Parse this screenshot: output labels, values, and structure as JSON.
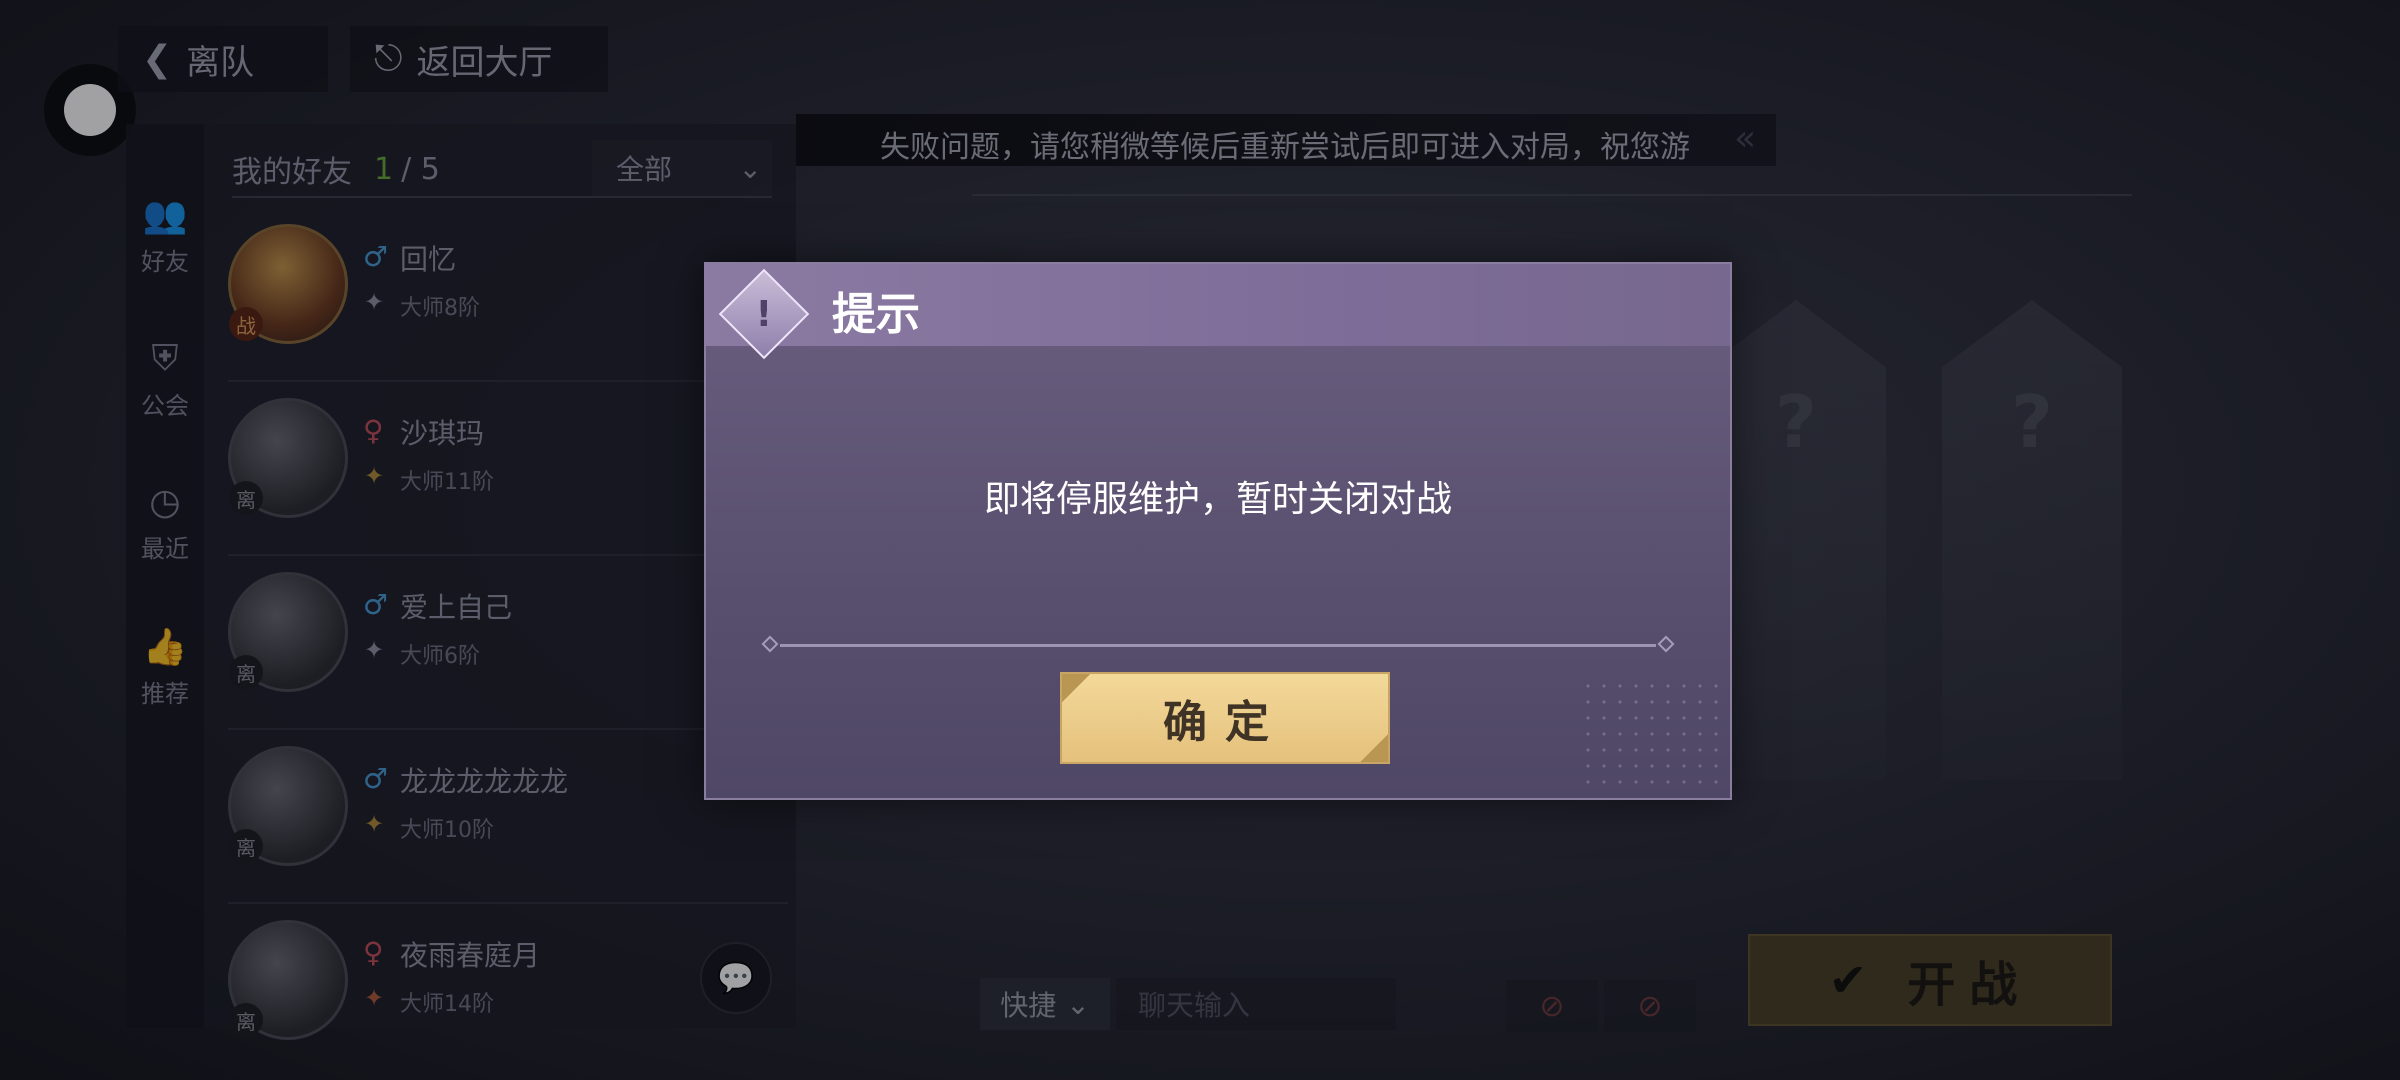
{
  "top": {
    "leave_label": "离队",
    "lobby_label": "返回大厅"
  },
  "side_tabs": [
    {
      "label": "好友",
      "icon": "people-icon"
    },
    {
      "label": "公会",
      "icon": "guild-shield-icon"
    },
    {
      "label": "最近",
      "icon": "clock-icon"
    },
    {
      "label": "推荐",
      "icon": "thumbs-up-icon"
    }
  ],
  "friends_panel": {
    "title": "我的好友",
    "online_count": "1",
    "total": "/ 5",
    "filter": "全部",
    "friends": [
      {
        "name": "回忆",
        "gender": "♂",
        "rank": "大师8阶",
        "status": "战"
      },
      {
        "name": "沙琪玛",
        "gender": "♀",
        "rank": "大师11阶",
        "status": "离"
      },
      {
        "name": "爱上自己",
        "gender": "♂",
        "rank": "大师6阶",
        "status": "离"
      },
      {
        "name": "龙龙龙龙龙龙",
        "gender": "♂",
        "rank": "大师10阶",
        "status": "离"
      },
      {
        "name": "夜雨春庭月",
        "gender": "♀",
        "rank": "大师14阶",
        "status": "离"
      }
    ]
  },
  "marquee": "失败问题，请您稍微等候后重新尝试后即可进入对局，祝您游",
  "slots": {
    "placeholder": "?"
  },
  "bottom_bar": {
    "quick_label": "快捷",
    "chat_placeholder": "聊天输入",
    "start_label": "开战"
  },
  "dialog": {
    "title": "提示",
    "message": "即将停服维护，暂时关闭对战",
    "confirm_label": "确定"
  },
  "colors": {
    "dialog_bg": "#5a5070",
    "dialog_header": "#8b7aa2",
    "confirm_button": "#f0d493",
    "online_count": "#6aa83a"
  }
}
